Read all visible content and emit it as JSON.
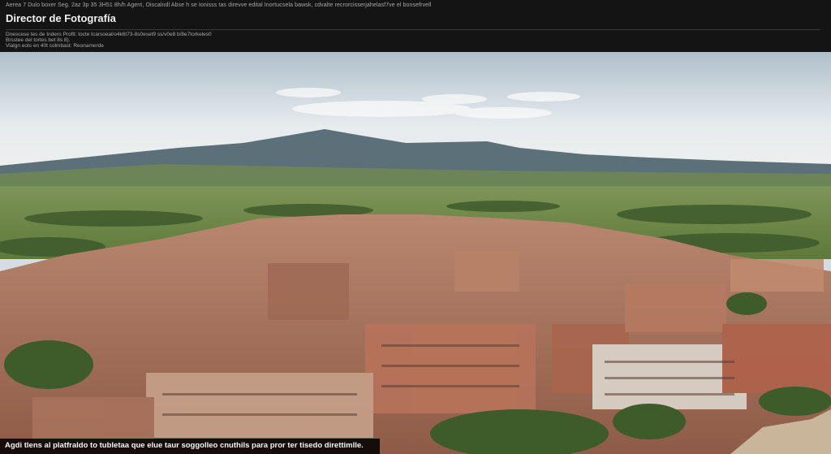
{
  "header": {
    "meta_line": "Aerea 7 Dulo boxer Seg. 2az 3p 35 3H51 8h/h Agent, Oiscalndl Abse h se Ionisss tas direvve edital Inortucsela  bawsk, cdvalte recrorcisserjahelasf7ve el bonsefrvell",
    "title": "Director de Fotografía",
    "description_lines": [
      "Dnescese tes de Indero Proflt: tocte tcarsoeal/o4k6t73-8s0eset9 ss/v0e8 b/8e7torkeles0",
      "Brsstee del tortes bet 8s 8).",
      "Vialgn eots en 40t colmbast: Reonamerde"
    ]
  },
  "photo": {
    "subject": "aerial-town-landscape"
  },
  "caption": {
    "text": "Agdi tlens al platfraldo to tubletaa que elue taur soggolleo cnuthils para pror ter tisedo direttimlle."
  },
  "colors": {
    "header_bg": "#141414",
    "sky_top": "#c9d6de",
    "mountain": "#4f6670",
    "field": "#8ea35a",
    "roof": "#b07a63"
  }
}
